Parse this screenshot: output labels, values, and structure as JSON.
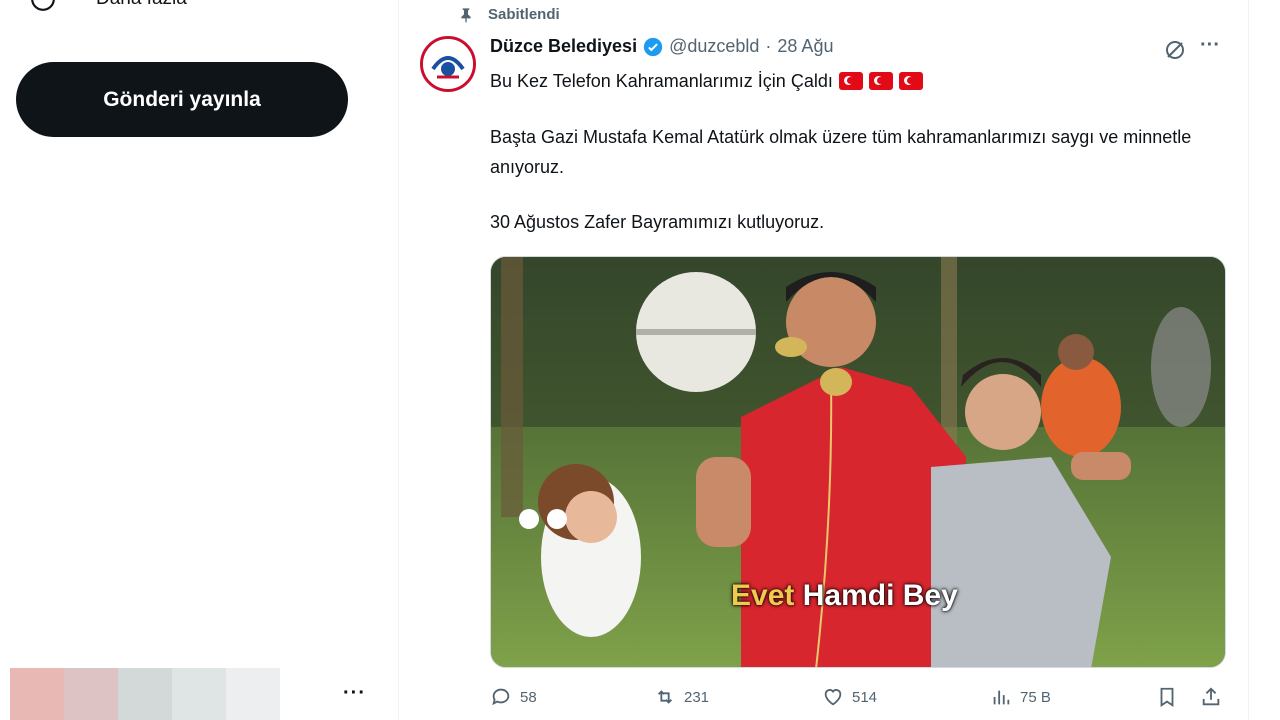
{
  "sidebar": {
    "cut_item_label": "Daha fazla",
    "post_button_label": "Gönderi yayınla",
    "more_label": "···"
  },
  "tweet": {
    "pinned_label": "Sabitlendi",
    "author_name": "Düzce Belediyesi",
    "handle": "@duzcebld",
    "separator": "·",
    "date": "28 Ağu",
    "menu_label": "···",
    "line1": "Bu Kez Telefon Kahramanlarımız İçin Çaldı",
    "line2": "Başta Gazi Mustafa Kemal Atatürk olmak üzere tüm kahramanlarımızı saygı ve minnetle anıyoruz.",
    "line3": "30 Ağustos Zafer Bayramımızı kutluyoruz.",
    "caption_yellow": "Evet",
    "caption_white": "Hamdi Bey",
    "stats": {
      "replies": "58",
      "reposts": "231",
      "likes": "514",
      "views": "75 B"
    }
  },
  "colors": {
    "accent": "#1d9bf0",
    "text": "#0f1419",
    "muted": "#536471",
    "flag_red": "#e30a17"
  },
  "icons": [
    "more-icon",
    "pin-icon",
    "verified-icon",
    "grok-icon",
    "reply-icon",
    "repost-icon",
    "like-icon",
    "views-icon",
    "bookmark-icon",
    "share-icon"
  ]
}
